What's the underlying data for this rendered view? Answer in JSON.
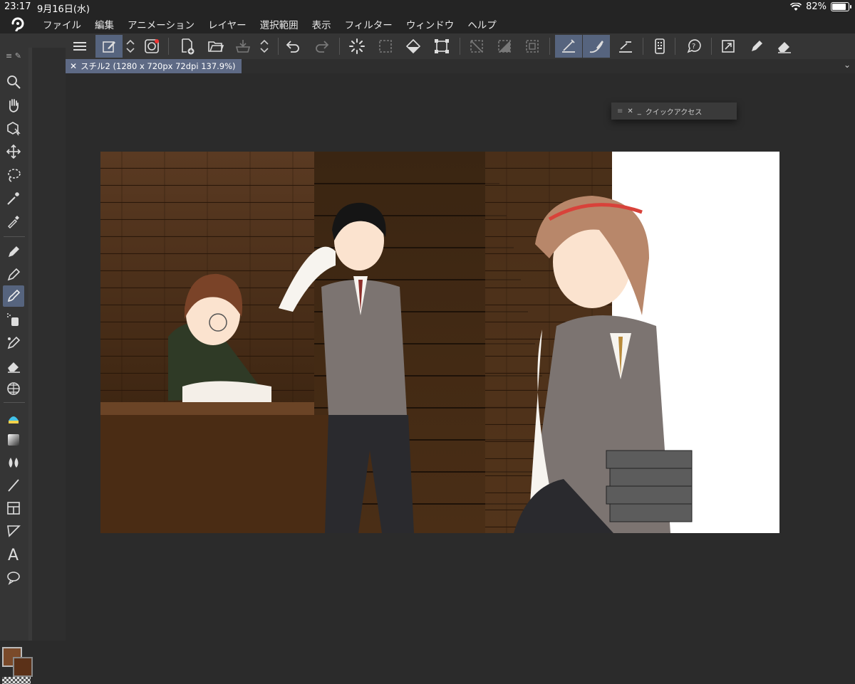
{
  "status_bar": {
    "time": "23:17",
    "date": "9月16日(水)",
    "battery": "82%"
  },
  "menu": {
    "items": [
      "ファイル",
      "編集",
      "アニメーション",
      "レイヤー",
      "選択範囲",
      "表示",
      "フィルター",
      "ウィンドウ",
      "ヘルプ"
    ]
  },
  "document": {
    "tab_label": "スチル2 (1280 x 720px 72dpi 137.9%)"
  },
  "quick_access": {
    "title": "クイックアクセス"
  },
  "colors": {
    "main_color": "#7a4a2a",
    "sub_color": "#5b3118",
    "active_highlight": "#56647e"
  },
  "toolbar_icons": [
    "menu-icon",
    "edit-icon",
    "updown-icon",
    "record-icon",
    "new-document-icon",
    "open-folder-icon",
    "save-cloud-icon",
    "updown-icon",
    "undo-icon",
    "redo-icon",
    "loading-icon",
    "clear-selection-icon",
    "fill-icon",
    "transform-icon",
    "hide-selection-icon",
    "invert-selection-icon",
    "select-all-icon",
    "ruler-snap-icon",
    "curve-snap-icon",
    "grid-snap-icon",
    "device-icon",
    "help-icon",
    "expand-icon",
    "pen-icon",
    "eraser-icon",
    "rotate-icon"
  ],
  "tool_icons": [
    "zoom-icon",
    "hand-icon",
    "object-icon",
    "move-icon",
    "lasso-icon",
    "magic-wand-icon",
    "eyedropper-icon",
    "pen-tool-icon",
    "pencil-tool-icon",
    "brush-tool-icon",
    "airbrush-icon",
    "decoration-icon",
    "eraser-tool-icon",
    "frame-icon",
    "fill-tool-icon",
    "gradient-icon",
    "blend-icon",
    "line-icon",
    "panel-icon",
    "ruler-icon",
    "text-icon",
    "balloon-icon"
  ]
}
